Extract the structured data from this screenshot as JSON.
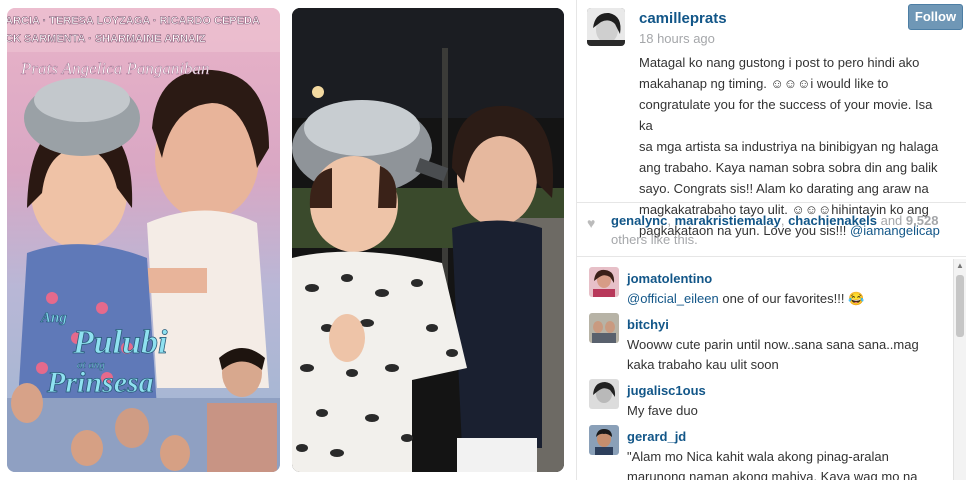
{
  "poster": {
    "cast_line_1": "ARCIA · TERESA LOYZAGA · RICARDO CEPEDA",
    "cast_line_2": "CK SARMENTA · SHARMAINE ARNAIZ",
    "stars_line": "Prats   Angelica Panganiban",
    "title_line_1": "Ang",
    "title_line_2": "Pulubi",
    "title_line_3": "at ang",
    "title_line_4": "Prinsesa"
  },
  "post": {
    "username": "camilleprats",
    "timestamp": "18 hours ago",
    "follow_label": "Follow",
    "caption_lines": [
      "Matagal ko nang gustong i post to pero hindi ako",
      "makahanap ng timing. ☺☺☺i would like to",
      "congratulate you for the success of your movie. Isa ka",
      "sa mga artista sa industriya na binibigyan ng halaga",
      "ang trabaho. Kaya naman sobra sobra din ang balik",
      "sayo. Congrats sis!! Alam ko darating ang araw na",
      "magkakatrabaho tayo ulit. ☺☺☺hihintayin ko ang",
      "pagkakataon na yun. Love you sis!!! "
    ],
    "caption_mention": "@iamangelicap"
  },
  "likes": {
    "likers": [
      "genalync",
      "marakristiemalay",
      "chachienakels"
    ],
    "and_text": "and",
    "count": "9,528",
    "suffix": "others like this."
  },
  "comments": [
    {
      "user": "jomatolentino",
      "mention": "@official_eileen",
      "lines": [
        " one of our favorites!!! 😂"
      ]
    },
    {
      "user": "bitchyi",
      "mention": "",
      "lines": [
        "Wooww cute parin until now..sana sana sana..mag",
        "kaka trabaho kau ulit soon"
      ]
    },
    {
      "user": "jugalisc1ous",
      "mention": "",
      "lines": [
        "My fave duo"
      ]
    },
    {
      "user": "gerard_jd",
      "mention": "",
      "lines": [
        "\"Alam mo Nica kahit wala akong pinag-aralan",
        "marunong naman akong mahiya. Kaya wag mo na"
      ]
    }
  ],
  "colors": {
    "link": "#125688",
    "muted": "#a5a7aa",
    "follow_bg": "#6f97b6",
    "text": "#333333"
  },
  "icons": {
    "heart": "heart-icon",
    "scroll_up": "scroll-up-arrow-icon"
  }
}
